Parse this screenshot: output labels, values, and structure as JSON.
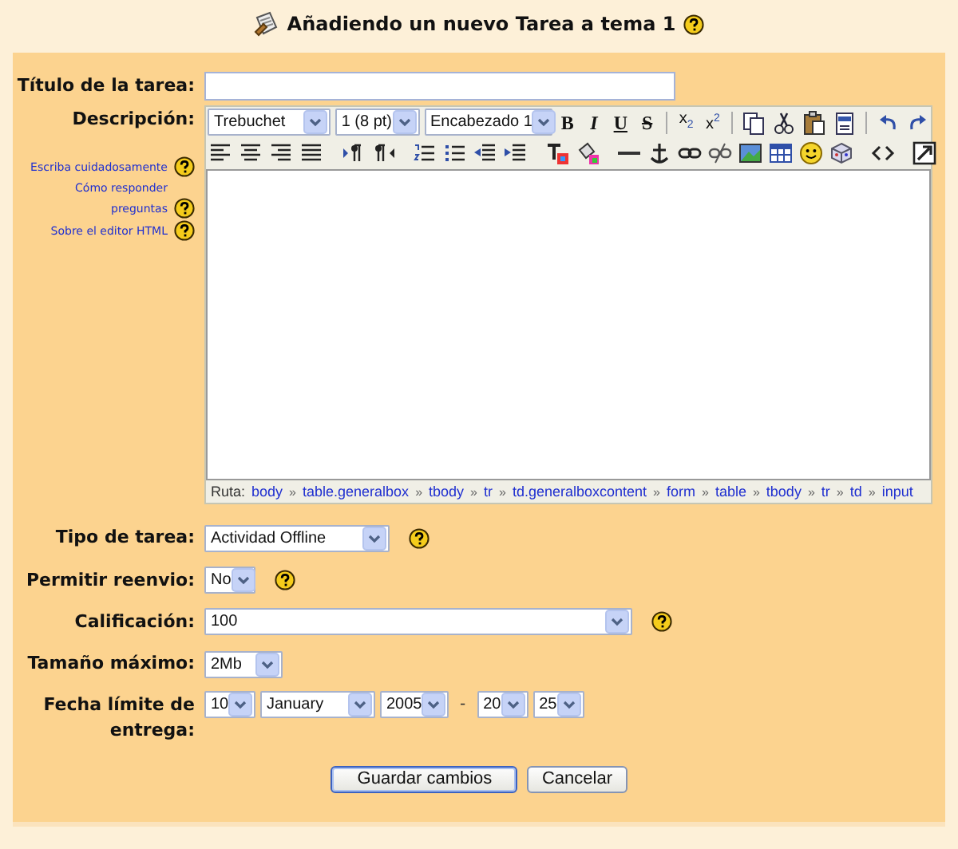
{
  "header": {
    "title": "Añadiendo un nuevo Tarea a tema 1"
  },
  "title_field": {
    "label": "Título de la tarea:"
  },
  "description": {
    "label": "Descripción:",
    "font": "Trebuchet",
    "size": "1 (8 pt)",
    "format": "Encabezado 1",
    "text_buttons": [
      {
        "text": "B",
        "kind": "bold"
      },
      {
        "text": "I",
        "kind": "italic"
      },
      {
        "text": "U",
        "kind": "underline"
      },
      {
        "text": "S",
        "kind": "strike"
      },
      {
        "text": "x",
        "sub": "2",
        "kind": "sub"
      },
      {
        "text": "x",
        "sup": "2",
        "kind": "sup"
      }
    ],
    "help_links": [
      {
        "text": "Escriba cuidadosamente"
      },
      {
        "text": "Cómo responder preguntas"
      },
      {
        "text": "Sobre el editor HTML"
      }
    ],
    "path_label": "Ruta:",
    "path": [
      {
        "text": "body"
      },
      {
        "sep": "»",
        "text": "table.generalbox"
      },
      {
        "sep": "»",
        "text": "tbody"
      },
      {
        "sep": "»",
        "text": "tr"
      },
      {
        "sep": "»",
        "text": "td.generalboxcontent"
      },
      {
        "sep": "»",
        "text": "form"
      },
      {
        "sep": "»",
        "text": "table"
      },
      {
        "sep": "»",
        "text": "tbody"
      },
      {
        "sep": "»",
        "text": "tr"
      },
      {
        "sep": "»",
        "text": "td"
      },
      {
        "sep": "»",
        "text": "input"
      }
    ]
  },
  "fields": [
    {
      "label": "Tipo de tarea:",
      "kind": "select",
      "value": "Actividad Offline",
      "help": true
    },
    {
      "label": "Permitir reenvio:",
      "kind": "select",
      "value": "No",
      "help": true
    },
    {
      "label": "Calificación:",
      "kind": "select",
      "value": "100",
      "help": true
    },
    {
      "label": "Tamaño máximo:",
      "kind": "select",
      "value": "2Mb",
      "help": false
    },
    {
      "label": "Fecha límite de entrega:",
      "kind": "date",
      "parts": [
        {
          "value": "10"
        },
        {
          "value": "January"
        },
        {
          "value": "2005"
        },
        {
          "sep": "-",
          "value": "20"
        },
        {
          "value": "25"
        }
      ]
    }
  ],
  "buttons": [
    {
      "text": "Guardar cambios",
      "default": true
    },
    {
      "text": "Cancelar",
      "default": false
    }
  ]
}
